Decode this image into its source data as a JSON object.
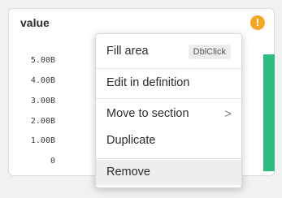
{
  "widget": {
    "title": "value",
    "warning_icon": "info-warning-icon",
    "warning_glyph": "!",
    "accent_color": "#2bbd7e",
    "warning_color": "#f5a623",
    "y_ticks": [
      "5.00B",
      "4.00B",
      "3.00B",
      "2.00B",
      "1.00B",
      "0"
    ]
  },
  "context_menu": {
    "fill_area": {
      "label": "Fill area",
      "shortcut": "DblClick"
    },
    "edit_in_definition": {
      "label": "Edit in definition"
    },
    "move_to_section": {
      "label": "Move to section",
      "chevron": ">"
    },
    "duplicate": {
      "label": "Duplicate"
    },
    "remove": {
      "label": "Remove"
    }
  }
}
